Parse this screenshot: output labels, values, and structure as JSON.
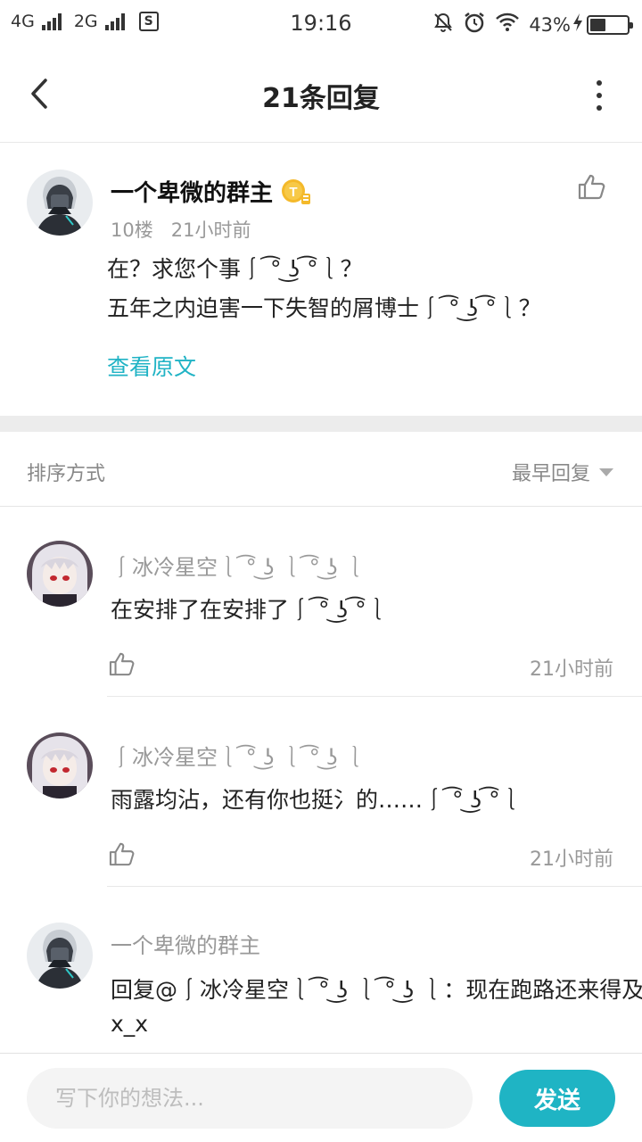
{
  "status_bar": {
    "network1": "4G",
    "network2": "2G",
    "sim_icon_label": "S",
    "time": "19:16",
    "battery_percent": "43%",
    "battery_level": 0.43,
    "icons": [
      "mute-bell-icon",
      "alarm-icon",
      "wifi-icon",
      "charging-bolt-icon",
      "battery-icon"
    ]
  },
  "nav": {
    "title": "21条回复",
    "back_icon": "chevron-left-icon",
    "more_icon": "more-vertical-icon"
  },
  "main_post": {
    "author": "一个卑微的群主",
    "badge_icon": "gold-t-badge-icon",
    "floor": "10楼",
    "time": "21小时前",
    "lines": [
      "在？求您个事⎰ ͡° ͜ʖ ͡°⎱？",
      "五年之内迫害一下失智的屑博士⎰ ͡° ͜ʖ ͡°⎱？"
    ],
    "view_original": "查看原文"
  },
  "sort": {
    "label": "排序方式",
    "selected": "最早回复"
  },
  "replies": [
    {
      "author": "⎰冰冷星空⎱ ͡° ͜ʖ ⎱ ͡° ͜ʖ ⎱",
      "text": "在安排了在安排了⎰ ͡° ͜ʖ ͡°⎱",
      "time": "21小时前",
      "avatar": "white-hair-girl"
    },
    {
      "author": "⎰冰冷星空⎱ ͡° ͜ʖ ⎱ ͡° ͜ʖ ⎱",
      "text": "雨露均沾，还有你也挺氵的……⎰ ͡° ͜ʖ ͡°⎱",
      "time": "21小时前",
      "avatar": "white-hair-girl"
    },
    {
      "author": "一个卑微的群主",
      "text_line1": "回复@⎰冰冷星空⎱ ͡° ͜ʖ ⎱ ͡° ͜ʖ ⎱：现在跑路还来得及吗",
      "text_line2": "x_x",
      "avatar": "masked-figure"
    }
  ],
  "composer": {
    "placeholder": "写下你的想法...",
    "send_label": "发送"
  },
  "colors": {
    "accent": "#1fb4c4",
    "link": "#20b3c5",
    "muted_text": "#999999",
    "divider": "#ececec"
  }
}
